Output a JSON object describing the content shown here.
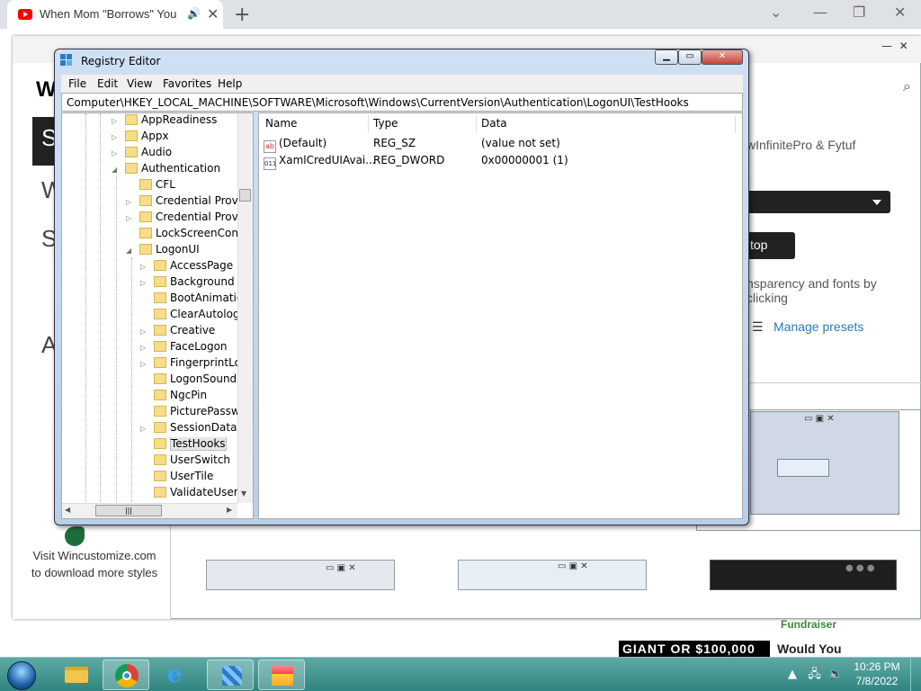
{
  "browser": {
    "tab_title": "When Mom \"Borrows\" Your I",
    "new_tab": "+",
    "controls": {
      "chevron": "⌄",
      "minimize": "—",
      "restore": "❐",
      "close": "✕"
    }
  },
  "background_page": {
    "heading_letter": "W",
    "side_block_letter": "S",
    "side_letters": [
      "W",
      "S",
      "A"
    ],
    "authors": "wInfinitePro & Fytuf",
    "button": "top",
    "hint": "nsparency and fonts by clicking",
    "manage_presets": "Manage presets",
    "visit_text": "Visit Wincustomize.com to download more styles"
  },
  "video_overlay": {
    "fundraiser": "Fundraiser",
    "giant_text": "GIANT OR $100,000",
    "would_you": "Would You"
  },
  "regedit": {
    "title": "Registry Editor",
    "menu": [
      "File",
      "Edit",
      "View",
      "Favorites",
      "Help"
    ],
    "address": "Computer\\HKEY_LOCAL_MACHINE\\SOFTWARE\\Microsoft\\Windows\\CurrentVersion\\Authentication\\LogonUI\\TestHooks",
    "tree": [
      "AppReadiness",
      "Appx",
      "Audio",
      "Authentication",
      "CFL",
      "Credential Provid",
      "Credential Provid",
      "LockScreenConte",
      "LogonUI",
      "AccessPage",
      "Background",
      "BootAnimatio",
      "ClearAutologo",
      "Creative",
      "FaceLogon",
      "FingerprintLog",
      "LogonSoundP",
      "NgcPin",
      "PicturePasswo",
      "SessionData",
      "TestHooks",
      "UserSwitch",
      "UserTile",
      "ValidateUserna"
    ],
    "columns": [
      "Name",
      "Type",
      "Data"
    ],
    "values": [
      {
        "name": "(Default)",
        "type": "REG_SZ",
        "data": "(value not set)",
        "icon": "ab"
      },
      {
        "name": "XamlCredUIAvai...",
        "type": "REG_DWORD",
        "data": "0x00000001 (1)",
        "icon": "011"
      }
    ]
  },
  "taskbar": {
    "time": "10:26 PM",
    "date": "7/8/2022"
  }
}
